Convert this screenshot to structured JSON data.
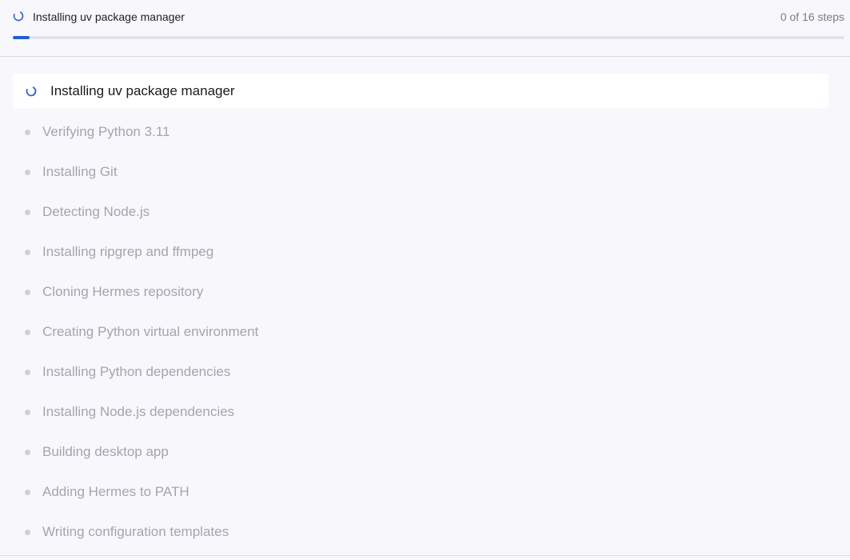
{
  "header": {
    "title": "Installing uv package manager",
    "step_count": "0 of 16 steps",
    "progress_fraction": 0.02,
    "icon": "spinner-icon"
  },
  "colors": {
    "accent": "#1f5fd6",
    "pending_text": "#a4a4ad"
  },
  "steps": {
    "current": {
      "label": "Installing uv package manager",
      "icon": "spinner-icon"
    },
    "pending": [
      {
        "label": "Verifying Python 3.11"
      },
      {
        "label": "Installing Git"
      },
      {
        "label": "Detecting Node.js"
      },
      {
        "label": "Installing ripgrep and ffmpeg"
      },
      {
        "label": "Cloning Hermes repository"
      },
      {
        "label": "Creating Python virtual environment"
      },
      {
        "label": "Installing Python dependencies"
      },
      {
        "label": "Installing Node.js dependencies"
      },
      {
        "label": "Building desktop app"
      },
      {
        "label": "Adding Hermes to PATH"
      },
      {
        "label": "Writing configuration templates"
      }
    ]
  }
}
